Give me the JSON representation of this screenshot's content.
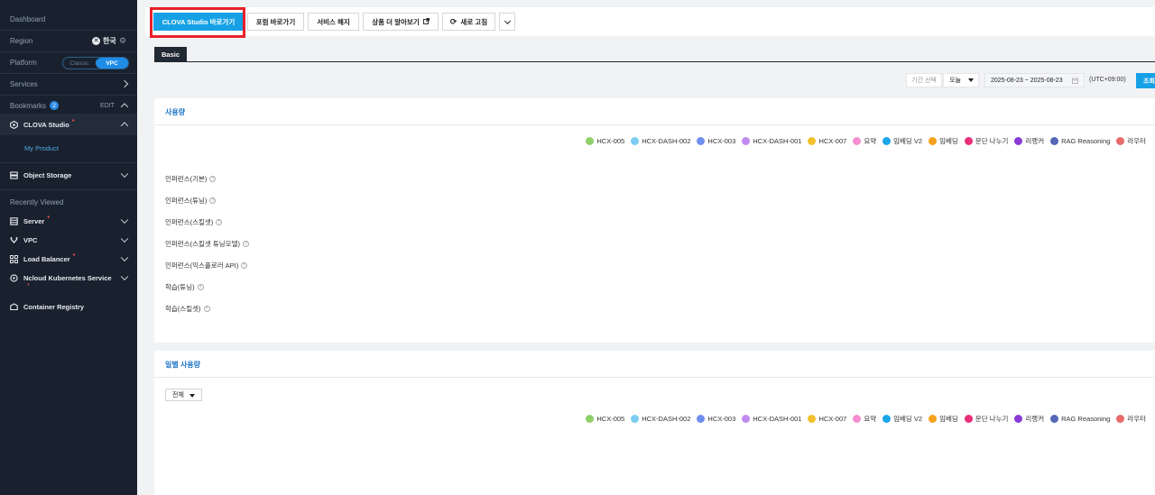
{
  "sidebar": {
    "dashboard": "Dashboard",
    "region_label": "Region",
    "region_value": "한국",
    "platform_label": "Platform",
    "platform_options": [
      "Classic",
      "VPC"
    ],
    "platform_selected": "VPC",
    "services_label": "Services",
    "bookmarks_label": "Bookmarks",
    "bookmarks_count": "2",
    "bookmarks_edit": "EDIT",
    "bookmark_items": [
      {
        "label": "CLOVA Studio",
        "new": true,
        "sub": [
          "My Product"
        ]
      },
      {
        "label": "Object Storage",
        "new": false
      }
    ],
    "recently_viewed_label": "Recently Viewed",
    "recent_items": [
      {
        "label": "Server",
        "new": true
      },
      {
        "label": "VPC",
        "new": false
      },
      {
        "label": "Load Balancer",
        "new": true
      },
      {
        "label": "Ncloud Kubernetes Service",
        "new": true
      },
      {
        "label": "Container Registry",
        "new": false
      }
    ],
    "new_marker": "*"
  },
  "toolbar": {
    "primary_label": "CLOVA Studio 바로가기",
    "forum_label": "포럼 바로가기",
    "cancel_label": "서비스 해지",
    "learn_more_label": "상품 더 알아보기",
    "refresh_label": "새로 고침"
  },
  "tabs": [
    "Basic"
  ],
  "filter": {
    "period_label": "기간 선택",
    "period_value": "오늘",
    "date_range": "2025-08-23 ~ 2025-08-23",
    "timezone": "(UTC+09:00)",
    "search_label": "조회"
  },
  "usage": {
    "title": "사용량",
    "metrics": [
      "인퍼런스(기본)",
      "인퍼런스(튜닝)",
      "인퍼런스(스킬셋)",
      "인퍼런스(스킬셋 튜닝모델)",
      "인퍼런스(익스플로러 API)",
      "학습(튜닝)",
      "학습(스킬셋)"
    ]
  },
  "daily": {
    "title": "일별 사용량",
    "select_value": "전체"
  },
  "legend": [
    {
      "name": "HCX-005",
      "color": "#8fcf6a"
    },
    {
      "name": "HCX-DASH-002",
      "color": "#7cccf3"
    },
    {
      "name": "HCX-003",
      "color": "#6f8ff0"
    },
    {
      "name": "HCX-DASH-001",
      "color": "#c08af0"
    },
    {
      "name": "HCX-007",
      "color": "#f2c12e"
    },
    {
      "name": "요약",
      "color": "#f58fd0"
    },
    {
      "name": "임베딩 V2",
      "color": "#1ba6e8"
    },
    {
      "name": "임베딩",
      "color": "#f5a21c"
    },
    {
      "name": "문단 나누기",
      "color": "#ec2d7a"
    },
    {
      "name": "리랭커",
      "color": "#8a3ad6"
    },
    {
      "name": "RAG Reasoning",
      "color": "#5667b8"
    },
    {
      "name": "라우터",
      "color": "#e86a6a"
    }
  ]
}
